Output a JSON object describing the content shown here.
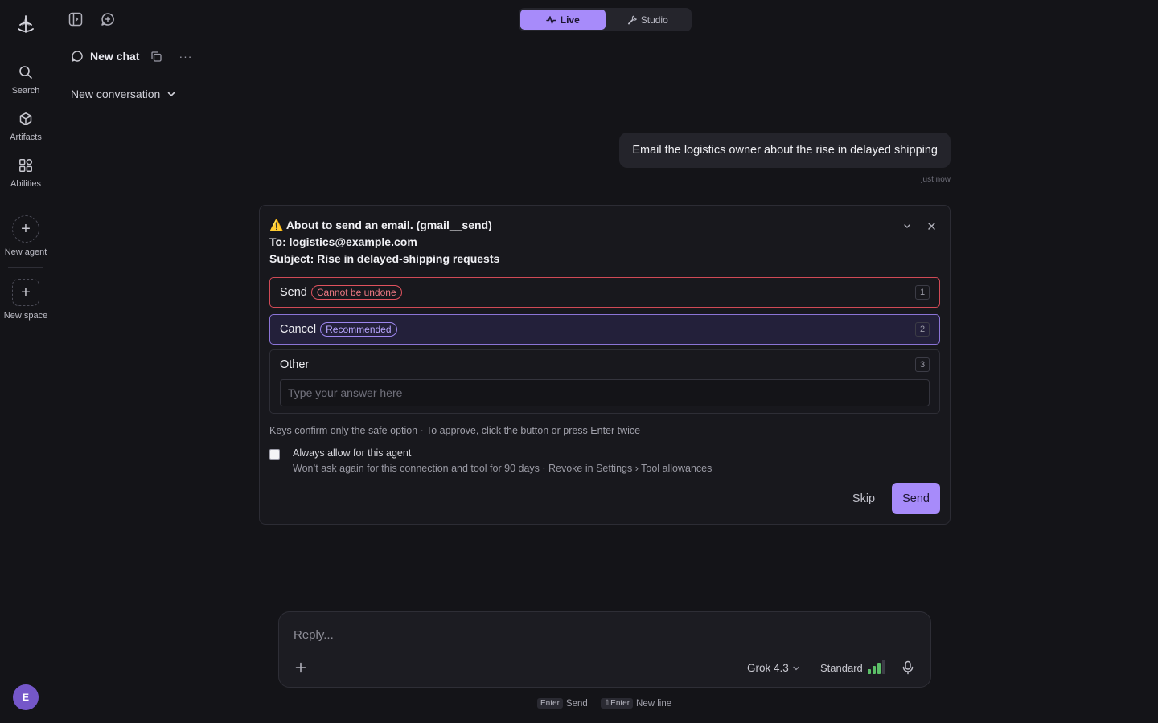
{
  "rail": {
    "items": [
      {
        "label": "Search",
        "icon": "search-icon"
      },
      {
        "label": "Artifacts",
        "icon": "box-icon"
      },
      {
        "label": "Abilities",
        "icon": "grid-icon"
      }
    ],
    "new_agent": "New agent",
    "new_space": "New space",
    "avatar": "E"
  },
  "header": {
    "chat_title": "New chat",
    "conversation_dropdown": "New conversation",
    "more": "···"
  },
  "mode_toggle": {
    "live": "Live",
    "studio": "Studio",
    "active": "Live"
  },
  "messages": [
    {
      "role": "user",
      "text": "Email the logistics owner about the rise in delayed shipping",
      "time": "just now"
    }
  ],
  "approval": {
    "warn_glyph": "⚠️",
    "title": "About to send an email. (gmail__send)",
    "to": "To: logistics@example.com",
    "subject": "Subject: Rise in delayed-shipping requests",
    "options": [
      {
        "label": "Send",
        "badge": "Cannot be undone",
        "key": "1"
      },
      {
        "label": "Cancel",
        "badge": "Recommended",
        "key": "2"
      },
      {
        "label": "Other",
        "key": "3",
        "placeholder": "Type your answer here"
      }
    ],
    "hint": "Keys confirm only the safe option · To approve, click the button or press Enter twice",
    "always_allow": {
      "label": "Always allow for this agent",
      "sub": "Won’t ask again for this connection and tool for 90 days · Revoke in Settings › Tool allowances",
      "checked": false
    },
    "skip_label": "Skip",
    "send_label": "Send"
  },
  "composer": {
    "placeholder": "Reply...",
    "model": "Grok 4.3",
    "mode": "Standard"
  },
  "shortcuts": {
    "send_key": "Enter",
    "send_label": "Send",
    "newline_key": "⇧Enter",
    "newline_label": "New line"
  },
  "colors": {
    "accent": "#a78bfa",
    "danger": "#e0525e",
    "bg": "#141418",
    "bars": "#5cbf68"
  }
}
